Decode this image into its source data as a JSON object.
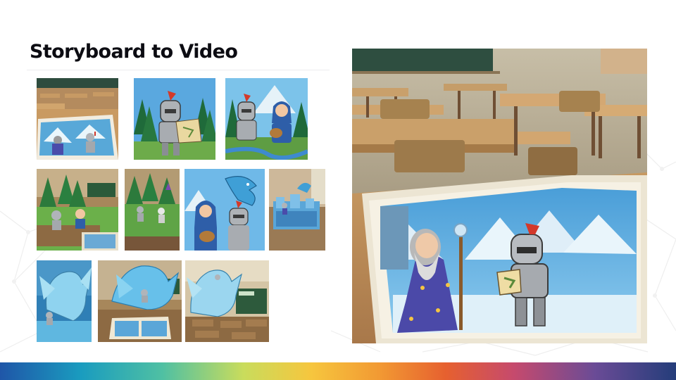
{
  "slide": {
    "title": "Storyboard to Video"
  },
  "storyboard": {
    "rows": [
      [
        "classroom-book-wizard-knight",
        "knight-forest-map",
        "knight-bard-forest"
      ],
      [
        "classroom-forest-diorama",
        "forest-diorama-closeup",
        "bard-knight-ice-dragon",
        "ice-castle-diorama"
      ],
      [
        "ice-dragon-diorama",
        "classroom-ice-dragon-book",
        "classroom-ice-dragon-knight"
      ]
    ]
  },
  "hero_image": "classroom-book-wizard-knight-large",
  "colors": {
    "title": "#0c0c12",
    "gradient": [
      "#1f56a8",
      "#1a9cbf",
      "#4fc0a3",
      "#c9dc5c",
      "#f6c63e",
      "#f29a33",
      "#e6602f",
      "#c64a6d",
      "#6a4b96",
      "#243d7a"
    ]
  }
}
